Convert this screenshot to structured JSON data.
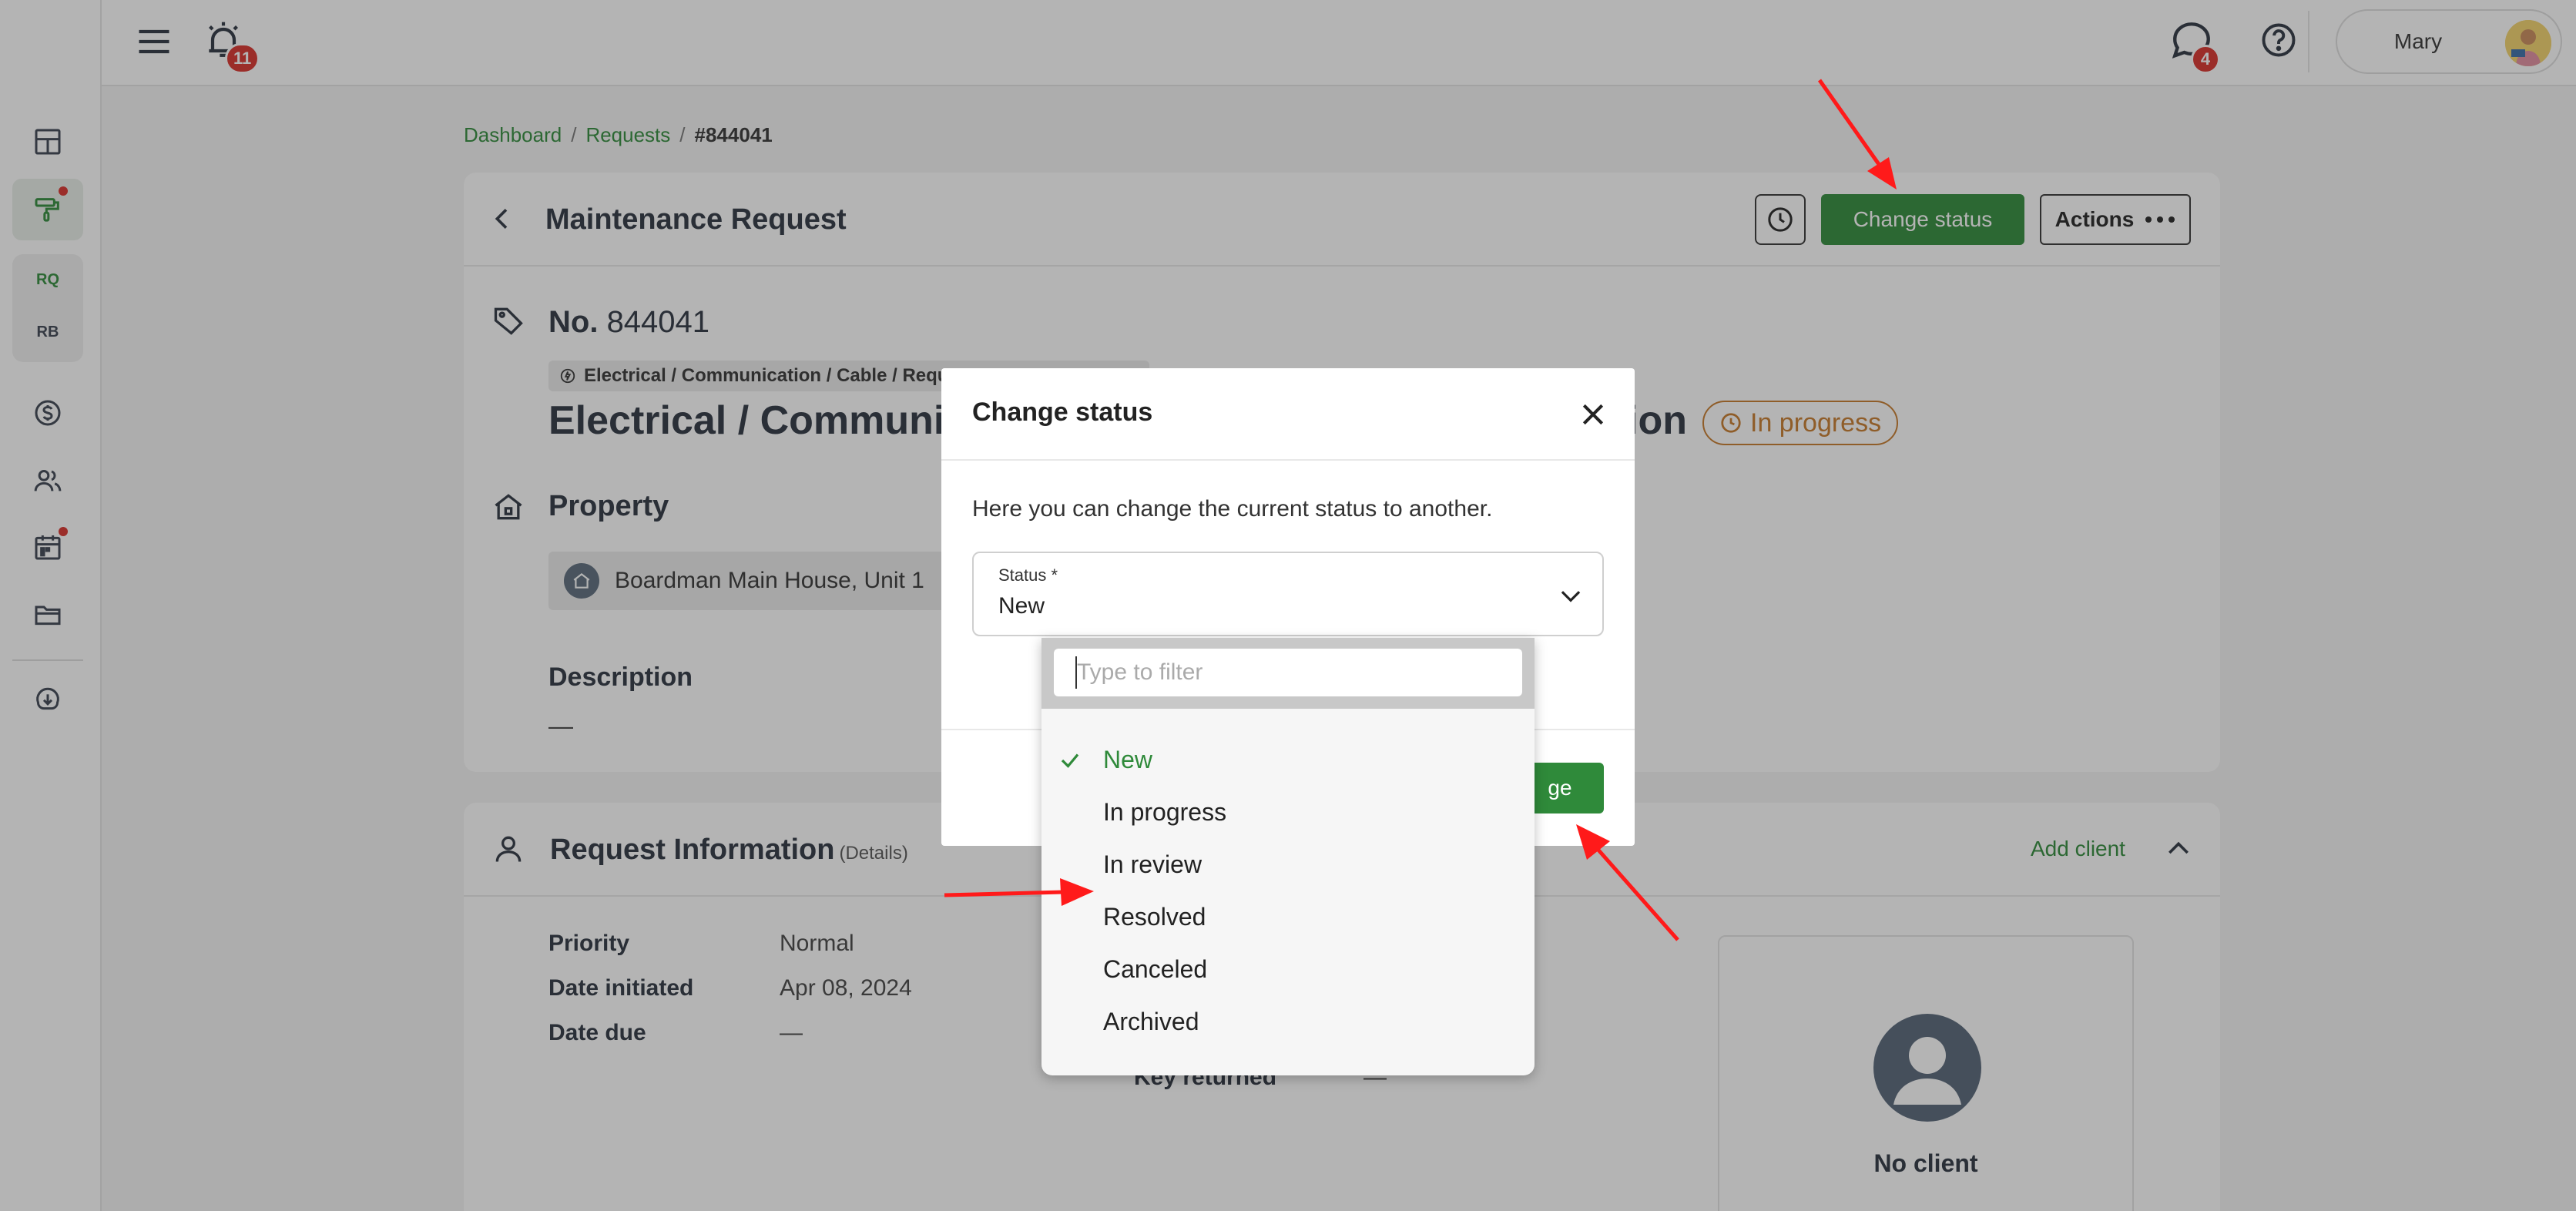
{
  "topbar": {
    "notifications_count": "11",
    "messages_count": "4",
    "user_name": "Mary"
  },
  "sidebar": {
    "items": [
      {
        "icon": "dashboard-icon"
      },
      {
        "icon": "paint-roller-icon",
        "active": true,
        "has_dot": true
      },
      {
        "label": "RQ",
        "active": true
      },
      {
        "label": "RB"
      },
      {
        "icon": "dollar-icon"
      },
      {
        "icon": "users-icon"
      },
      {
        "icon": "calendar-icon",
        "has_dot": true
      },
      {
        "icon": "folder-icon"
      },
      {
        "icon": "cloud-download-icon"
      }
    ]
  },
  "breadcrumb": {
    "items": [
      "Dashboard",
      "Requests",
      "#844041"
    ],
    "separator": "/"
  },
  "request": {
    "page_title": "Maintenance Request",
    "change_status_label": "Change status",
    "actions_label": "Actions",
    "number_prefix": "No.",
    "number": "844041",
    "category_path": "Electrical / Communication / Cable / Reque",
    "heading": "Electrical / Communica",
    "heading_tail": "ion",
    "status": "In progress",
    "property_title": "Property",
    "property_name": "Boardman Main House, Unit 1",
    "description_title": "Description",
    "description_value": "—"
  },
  "request_info": {
    "title": "Request Information",
    "subtitle": "(Details)",
    "add_client_label": "Add client",
    "rows": [
      {
        "label": "Priority",
        "value": "Normal"
      },
      {
        "label": "Date initiated",
        "value": "Apr 08, 2024"
      },
      {
        "label": "Date due",
        "value": "—"
      }
    ],
    "key_returned_label": "Key returned",
    "key_returned_value": "—",
    "no_client_label": "No client"
  },
  "modal": {
    "title": "Change status",
    "description": "Here you can change the current status to another.",
    "field_label": "Status *",
    "field_value": "New",
    "save_label": "ge"
  },
  "dropdown": {
    "filter_placeholder": "Type to filter",
    "options": [
      {
        "label": "New",
        "selected": true
      },
      {
        "label": "In progress"
      },
      {
        "label": "In review"
      },
      {
        "label": "Resolved"
      },
      {
        "label": "Canceled"
      },
      {
        "label": "Archived"
      }
    ]
  },
  "colors": {
    "accent": "#2f8a3a",
    "status_in_progress": "#c77a2a",
    "badge": "#d9302a",
    "annotation_arrow": "#ff1a1a"
  }
}
